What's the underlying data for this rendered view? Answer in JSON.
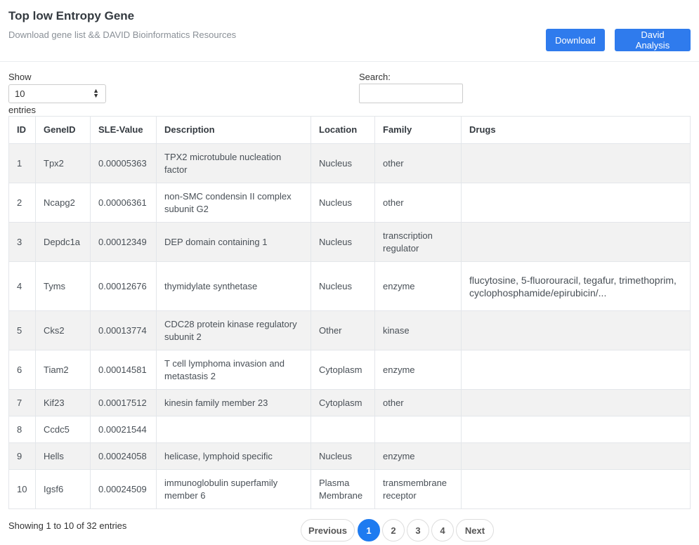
{
  "header": {
    "title": "Top low Entropy Gene",
    "subtitle": "Download gene list && DAVID Bioinformatics Resources",
    "download_label": "Download",
    "david_label": "David Analysis"
  },
  "controls": {
    "show_label": "Show",
    "entries_value": "10",
    "entries_label": "entries",
    "search_label": "Search:",
    "search_value": ""
  },
  "table": {
    "columns": [
      "ID",
      "GeneID",
      "SLE-Value",
      "Description",
      "Location",
      "Family",
      "Drugs"
    ],
    "rows": [
      {
        "id": "1",
        "gene": "Tpx2",
        "sle": "0.00005363",
        "desc": "TPX2 microtubule nucleation factor",
        "loc": "Nucleus",
        "family": "other",
        "drugs": ""
      },
      {
        "id": "2",
        "gene": "Ncapg2",
        "sle": "0.00006361",
        "desc": "non-SMC condensin II complex subunit G2",
        "loc": "Nucleus",
        "family": "other",
        "drugs": ""
      },
      {
        "id": "3",
        "gene": "Depdc1a",
        "sle": "0.00012349",
        "desc": "DEP domain containing 1",
        "loc": "Nucleus",
        "family": "transcription regulator",
        "drugs": ""
      },
      {
        "id": "4",
        "gene": "Tyms",
        "sle": "0.00012676",
        "desc": "thymidylate synthetase",
        "loc": "Nucleus",
        "family": "enzyme",
        "drugs": "flucytosine, 5-fluorouracil, tegafur, trimethoprim, cyclophosphamide/epirubicin/..."
      },
      {
        "id": "5",
        "gene": "Cks2",
        "sle": "0.00013774",
        "desc": "CDC28 protein kinase regulatory subunit 2",
        "loc": "Other",
        "family": "kinase",
        "drugs": ""
      },
      {
        "id": "6",
        "gene": "Tiam2",
        "sle": "0.00014581",
        "desc": "T cell lymphoma invasion and metastasis 2",
        "loc": "Cytoplasm",
        "family": "enzyme",
        "drugs": ""
      },
      {
        "id": "7",
        "gene": "Kif23",
        "sle": "0.00017512",
        "desc": "kinesin family member 23",
        "loc": "Cytoplasm",
        "family": "other",
        "drugs": ""
      },
      {
        "id": "8",
        "gene": "Ccdc5",
        "sle": "0.00021544",
        "desc": "",
        "loc": "",
        "family": "",
        "drugs": ""
      },
      {
        "id": "9",
        "gene": "Hells",
        "sle": "0.00024058",
        "desc": "helicase, lymphoid specific",
        "loc": "Nucleus",
        "family": "enzyme",
        "drugs": ""
      },
      {
        "id": "10",
        "gene": "Igsf6",
        "sle": "0.00024509",
        "desc": "immunoglobulin superfamily member 6",
        "loc": "Plasma Membrane",
        "family": "transmembrane receptor",
        "drugs": ""
      }
    ]
  },
  "footer": {
    "info": "Showing 1 to 10 of 32 entries",
    "previous": "Previous",
    "next": "Next",
    "pages": [
      "1",
      "2",
      "3",
      "4"
    ]
  },
  "colors": {
    "accent": "#2f7bed",
    "row_stripe": "#f2f2f2"
  }
}
